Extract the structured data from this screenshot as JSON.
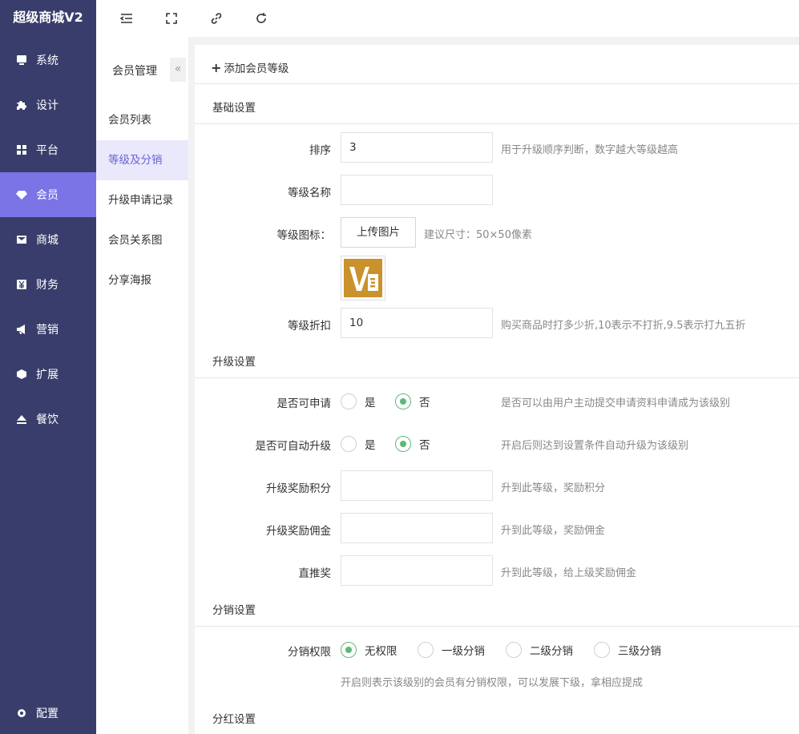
{
  "app": {
    "title": "超级商城V2"
  },
  "sidebar": {
    "items": [
      {
        "label": "系统",
        "icon": "monitor-icon"
      },
      {
        "label": "设计",
        "icon": "puzzle-icon"
      },
      {
        "label": "平台",
        "icon": "grid-icon"
      },
      {
        "label": "会员",
        "icon": "gem-icon"
      },
      {
        "label": "商城",
        "icon": "mail-icon"
      },
      {
        "label": "财务",
        "icon": "yen-icon"
      },
      {
        "label": "营销",
        "icon": "megaphone-icon"
      },
      {
        "label": "扩展",
        "icon": "cube-icon"
      },
      {
        "label": "餐饮",
        "icon": "eject-icon"
      }
    ],
    "active": "会员",
    "config_label": "配置"
  },
  "topbar": {
    "icons": [
      "menu-fold-icon",
      "fullscreen-icon",
      "link-icon",
      "refresh-icon"
    ]
  },
  "subnav": {
    "title": "会员管理",
    "collapse_glyph": "«",
    "items": [
      "会员列表",
      "等级及分销",
      "升级申请记录",
      "会员关系图",
      "分享海报"
    ],
    "active": "等级及分销"
  },
  "form": {
    "add_label": "添加会员等级",
    "sections": {
      "basic": "基础设置",
      "upgrade": "升级设置",
      "distribution": "分销设置",
      "dividend": "分红设置"
    },
    "sort": {
      "label": "排序",
      "value": "3",
      "hint": "用于升级顺序判断，数字越大等级越高"
    },
    "level_name": {
      "label": "等级名称",
      "value": ""
    },
    "level_icon": {
      "label": "等级图标：",
      "button": "上传图片",
      "hint": "建议尺寸：50×50像素",
      "logo_text": "V∃"
    },
    "discount": {
      "label": "等级折扣",
      "value": "10",
      "hint": "购买商品时打多少折,10表示不打折,9.5表示打九五折"
    },
    "can_apply": {
      "label": "是否可申请",
      "options": [
        "是",
        "否"
      ],
      "selected": "否",
      "hint": "是否可以由用户主动提交申请资料申请成为该级别"
    },
    "auto_upgrade": {
      "label": "是否可自动升级",
      "options": [
        "是",
        "否"
      ],
      "selected": "否",
      "hint": "开启后则达到设置条件自动升级为该级别"
    },
    "reward_points": {
      "label": "升级奖励积分",
      "value": "",
      "hint": "升到此等级，奖励积分"
    },
    "reward_commission": {
      "label": "升级奖励佣金",
      "value": "",
      "hint": "升到此等级，奖励佣金"
    },
    "direct_reward": {
      "label": "直推奖",
      "value": "",
      "hint": "升到此等级，给上级奖励佣金"
    },
    "dist_permission": {
      "label": "分销权限",
      "options": [
        "无权限",
        "一级分销",
        "二级分销",
        "三级分销"
      ],
      "selected": "无权限",
      "hint": "开启则表示该级别的会员有分销权限，可以发展下级，拿相应提成"
    }
  }
}
